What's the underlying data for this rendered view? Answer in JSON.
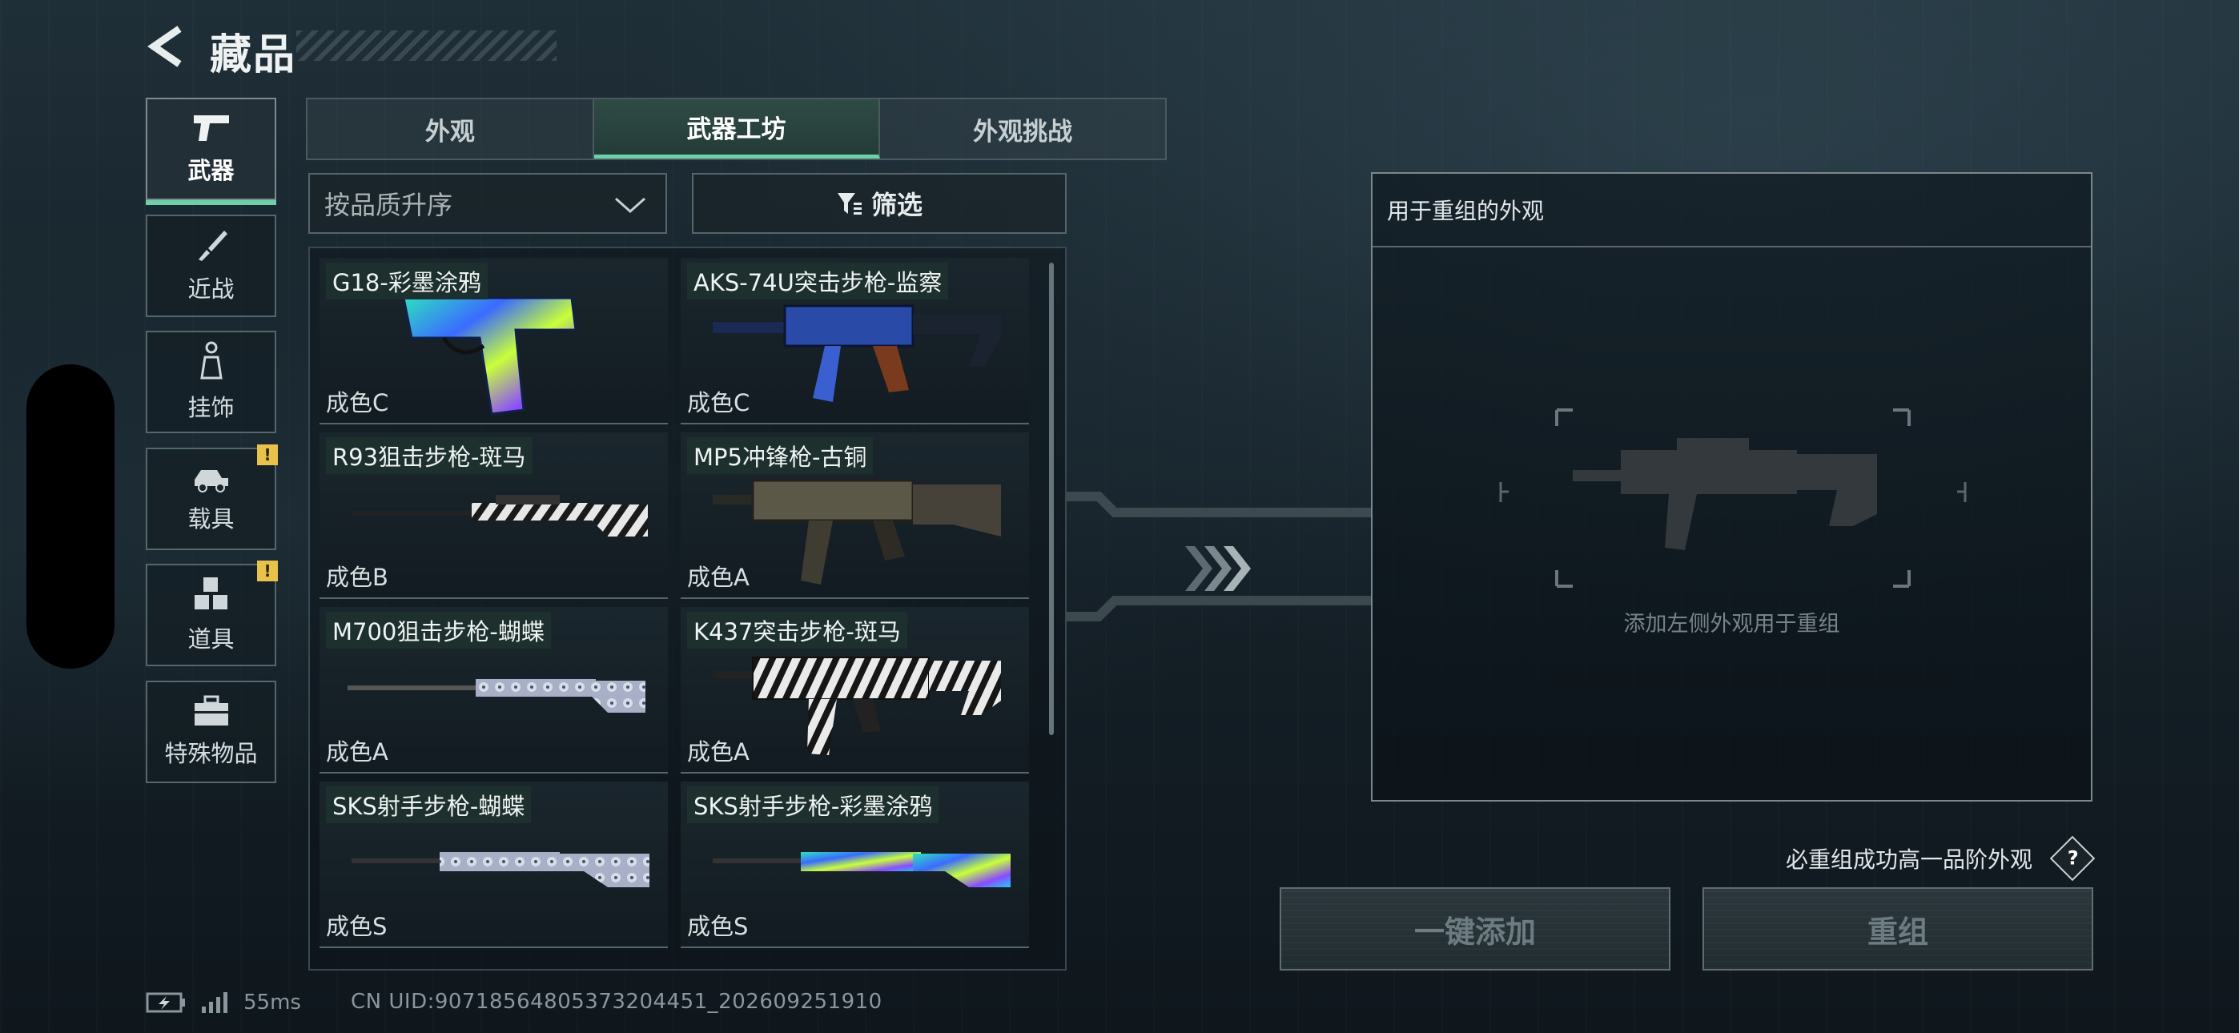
{
  "header": {
    "title": "藏品"
  },
  "categories": [
    {
      "label": "武器",
      "icon": "pistol-icon",
      "active": true
    },
    {
      "label": "近战",
      "icon": "knife-icon"
    },
    {
      "label": "挂饰",
      "icon": "charm-icon"
    },
    {
      "label": "载具",
      "icon": "vehicle-icon",
      "alert": "!"
    },
    {
      "label": "道具",
      "icon": "cubes-icon",
      "alert": "!"
    },
    {
      "label": "特殊物品",
      "icon": "briefcase-icon"
    }
  ],
  "tabs": [
    "外观",
    "武器工坊",
    "外观挑战"
  ],
  "active_tab": 1,
  "sort": {
    "value": "按品质升序"
  },
  "filter": {
    "label": "筛选"
  },
  "items": [
    {
      "name": "G18-彩墨涂鸦",
      "grade": "成色C"
    },
    {
      "name": "AKS-74U突击步枪-监察",
      "grade": "成色C"
    },
    {
      "name": "R93狙击步枪-斑马",
      "grade": "成色B"
    },
    {
      "name": "MP5冲锋枪-古铜",
      "grade": "成色A"
    },
    {
      "name": "M700狙击步枪-蝴蝶",
      "grade": "成色A"
    },
    {
      "name": "K437突击步枪-斑马",
      "grade": "成色A"
    },
    {
      "name": "SKS射手步枪-蝴蝶",
      "grade": "成色S"
    },
    {
      "name": "SKS射手步枪-彩墨涂鸦",
      "grade": "成色S"
    }
  ],
  "panel": {
    "title": "用于重组的外观",
    "placeholder": "添加左侧外观用于重组"
  },
  "hint": "必重组成功高一品阶外观",
  "help_label": "?",
  "buttons": {
    "add": "一键添加",
    "reassemble": "重组"
  },
  "status": {
    "ping": "55ms",
    "uid": "CN UID:90718564805373204451_202609251910"
  },
  "colors": {
    "accent": "#6cd0a8",
    "alert": "#e8c24a"
  }
}
